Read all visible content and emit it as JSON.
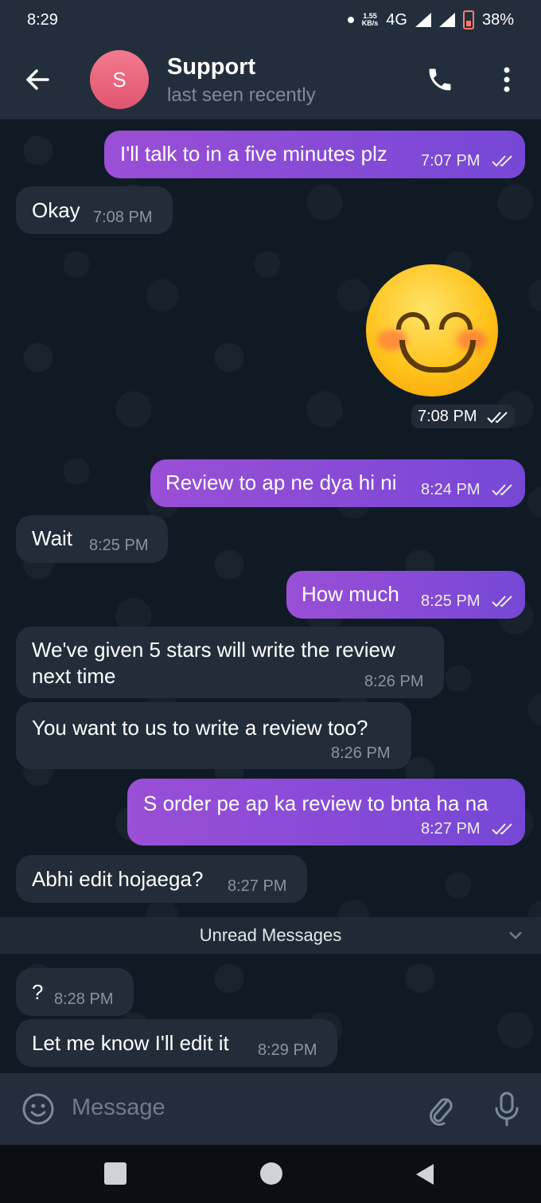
{
  "status_bar": {
    "time": "8:29",
    "net_speed_top": "1.55",
    "net_speed_bottom": "KB/s",
    "network": "4G",
    "battery": "38%"
  },
  "header": {
    "avatar_letter": "S",
    "title": "Support",
    "subtitle": "last seen recently",
    "back_icon": "back-arrow-icon",
    "call_icon": "phone-icon",
    "menu_icon": "more-vertical-icon",
    "avatar_color": "#eb6a82"
  },
  "messages": [
    {
      "dir": "out",
      "text": "I'll talk to in a five minutes plz",
      "time": "7:07 PM",
      "read": true
    },
    {
      "dir": "in",
      "text": "Okay",
      "time": "7:08 PM"
    },
    {
      "dir": "out",
      "type": "sticker",
      "emoji": "smiling-face-with-smiling-eyes",
      "time": "7:08 PM",
      "read": true
    },
    {
      "dir": "out",
      "text": "Review to ap ne dya hi ni",
      "time": "8:24 PM",
      "read": true
    },
    {
      "dir": "in",
      "text": "Wait",
      "time": "8:25 PM"
    },
    {
      "dir": "out",
      "text": "How much",
      "time": "8:25 PM",
      "read": true
    },
    {
      "dir": "in",
      "text_lines": [
        "We've given 5 stars will write the review",
        "next time"
      ],
      "time": "8:26 PM"
    },
    {
      "dir": "in",
      "text": "You want to us to write a review too?",
      "time": "8:26 PM"
    },
    {
      "dir": "out",
      "text": "S order pe ap ka review to bnta ha na",
      "time": "8:27 PM",
      "read": true
    },
    {
      "dir": "in",
      "text": "Abhi edit hojaega?",
      "time": "8:27 PM"
    },
    {
      "dir": "in",
      "text": "?",
      "time": "8:28 PM"
    },
    {
      "dir": "in",
      "text": "Let me know I'll edit it",
      "time": "8:29 PM"
    }
  ],
  "unread_divider": "Unread Messages",
  "input": {
    "placeholder": "Message",
    "emoji_icon": "emoji-icon",
    "attach_icon": "paperclip-icon",
    "mic_icon": "microphone-icon"
  },
  "nav": {
    "recents_icon": "recents-square-icon",
    "home_icon": "home-circle-icon",
    "back_icon": "back-triangle-icon"
  },
  "colors": {
    "background": "#0f1a24",
    "header": "#232e3c",
    "incoming_bubble": "#222d39",
    "outgoing_bubble_start": "#9a4fd6",
    "outgoing_bubble_end": "#7647d6"
  }
}
